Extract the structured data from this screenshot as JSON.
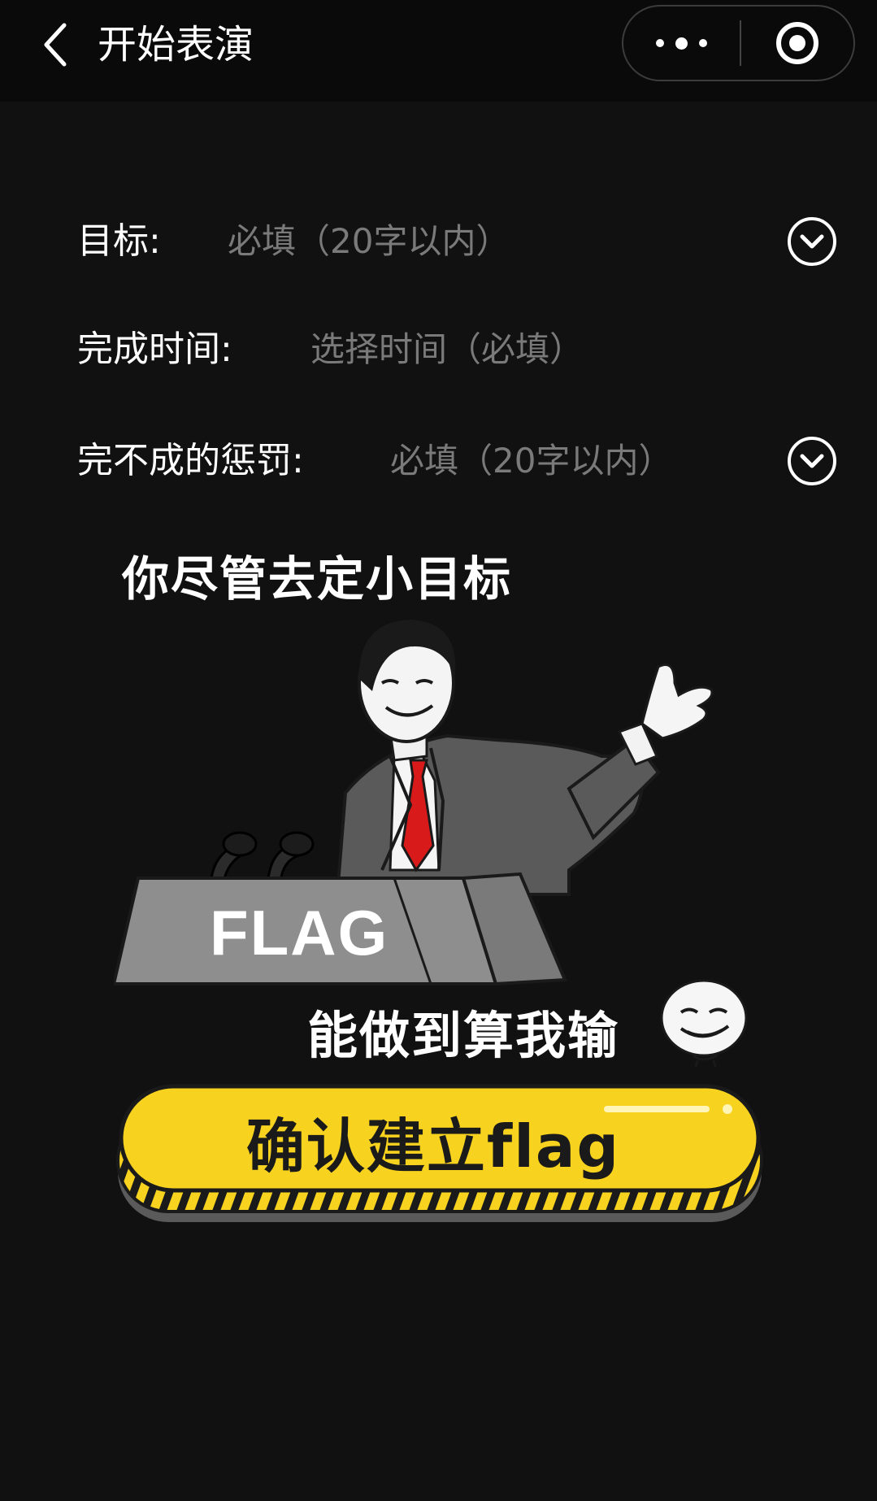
{
  "nav": {
    "title": "开始表演"
  },
  "form": {
    "goal": {
      "label": "目标:",
      "placeholder": "必填（20字以内）"
    },
    "time": {
      "label": "完成时间:",
      "placeholder": "选择时间（必填）"
    },
    "penalty": {
      "label": "完不成的惩罚:",
      "placeholder": "必填（20字以内）"
    }
  },
  "meme": {
    "caption_top": "你尽管去定小目标",
    "podium_text": "FLAG",
    "caption_bottom": "能做到算我输"
  },
  "confirm": {
    "label": "确认建立flag"
  },
  "colors": {
    "background": "#111111",
    "button_yellow": "#f7d21e",
    "tie_red": "#d91a1a",
    "placeholder": "#7a7a7a"
  }
}
